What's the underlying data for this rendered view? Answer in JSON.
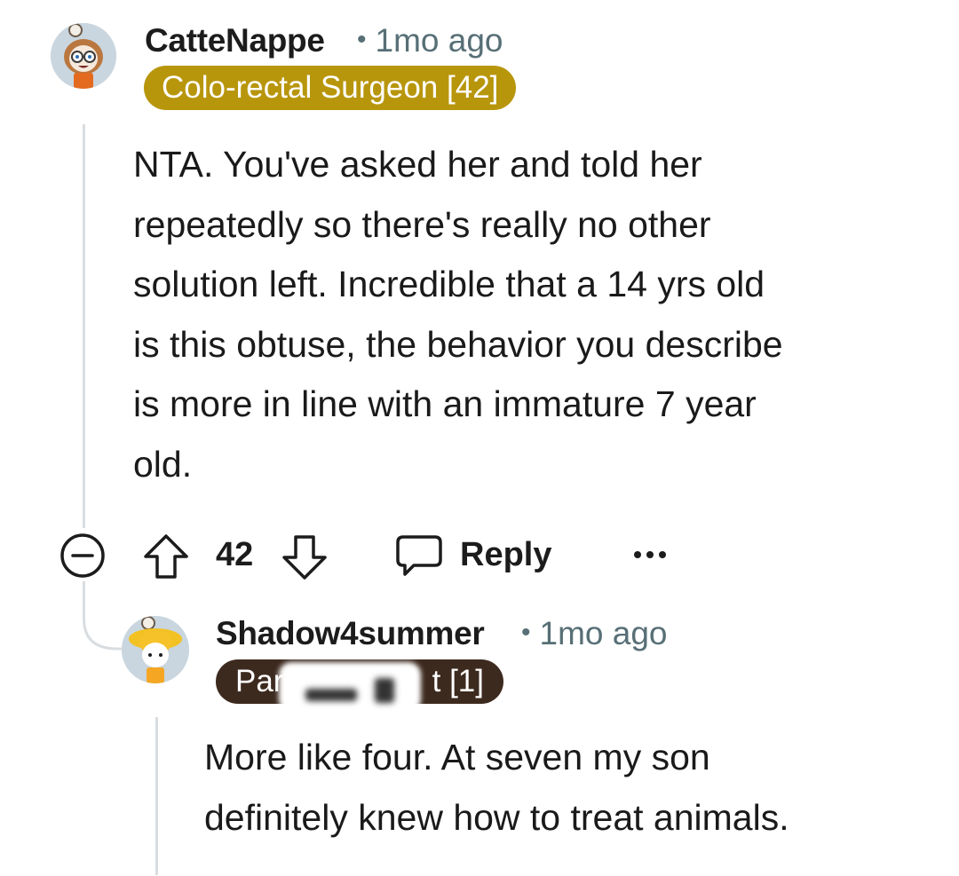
{
  "comments": [
    {
      "username": "CatteNappe",
      "time": "1mo ago",
      "flair": "Colo-rectal Surgeon [42]",
      "flair_color": "#b8960c",
      "body_lines": [
        "NTA. You've asked her and told her",
        "repeatedly so there's really no other",
        "solution left. Incredible that a 14 yrs old",
        "is this obtuse, the behavior you describe",
        "is more in line with an immature 7 year",
        "old."
      ],
      "actions": {
        "score": "42",
        "reply_label": "Reply"
      }
    },
    {
      "username": "Shadow4summer",
      "time": "1mo ago",
      "flair_start": "Par",
      "flair_end": "t [1]",
      "flair_color": "#3d2a1f",
      "body_lines": [
        "More like four. At seven my son",
        "definitely knew how to treat animals."
      ]
    }
  ],
  "icons": {
    "collapse": "collapse-minus-icon",
    "upvote": "upvote-arrow-icon",
    "downvote": "downvote-arrow-icon",
    "reply": "reply-bubble-icon",
    "more": "more-options-icon"
  }
}
